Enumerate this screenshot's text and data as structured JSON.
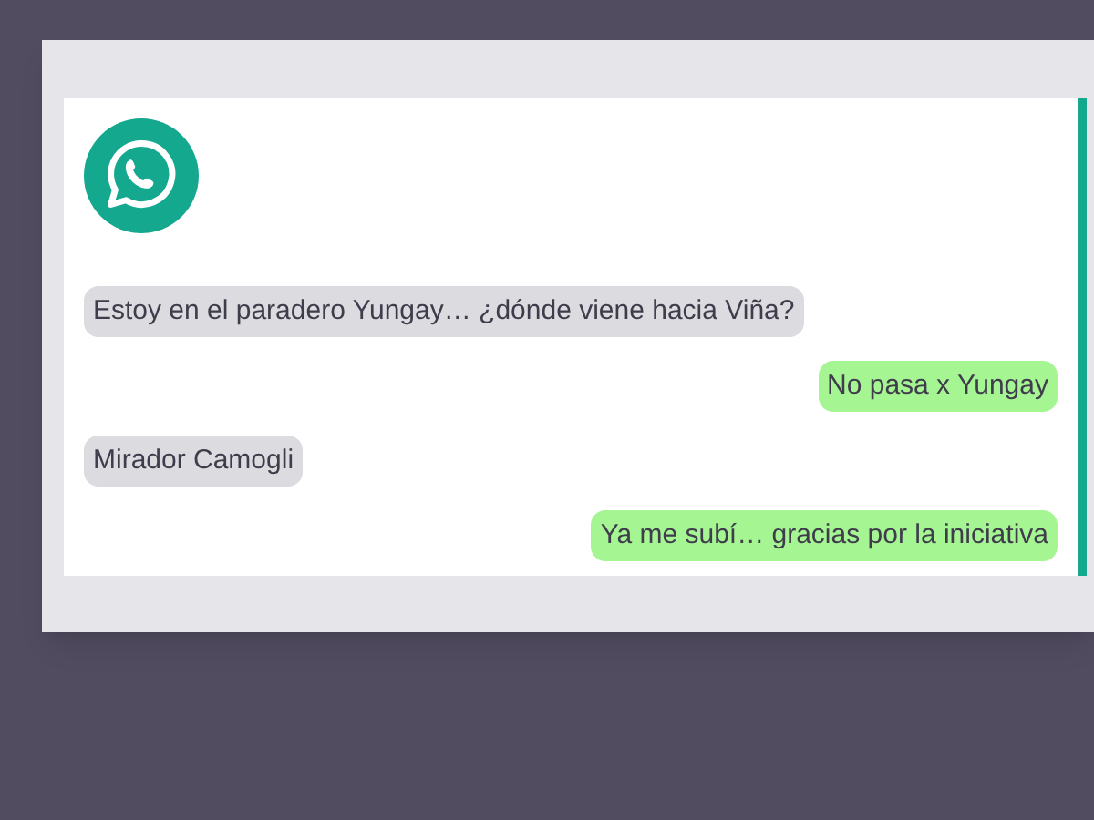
{
  "messages": [
    {
      "kind": "received",
      "text": "Estoy en el paradero Yungay… ¿dónde viene hacia Viña?"
    },
    {
      "kind": "sent",
      "text": "No pasa x Yungay"
    },
    {
      "kind": "received",
      "text": "Mirador Camogli"
    },
    {
      "kind": "sent",
      "text": "Ya me subí… gracias por la iniciativa"
    }
  ]
}
